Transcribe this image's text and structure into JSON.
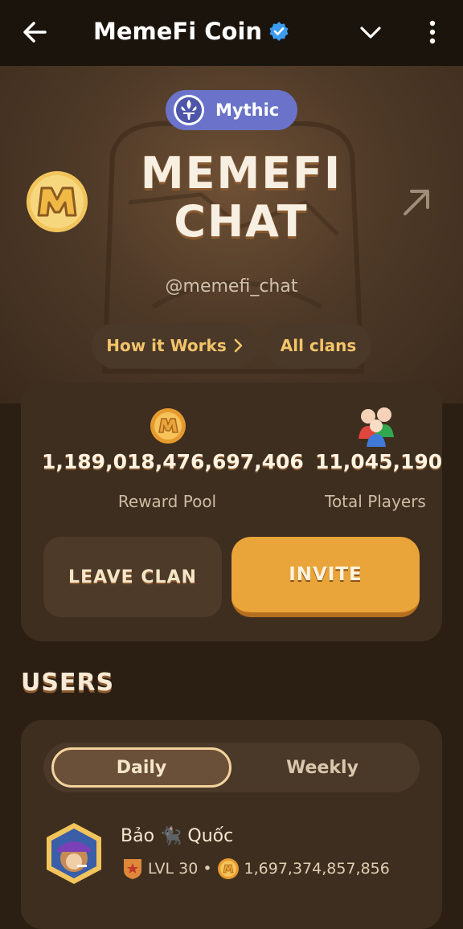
{
  "appbar": {
    "title": "MemeFi Coin"
  },
  "clan": {
    "tier": "Mythic",
    "name_line1": "MEMEFI",
    "name_line2": "CHAT",
    "handle": "@memefi_chat",
    "how_it_works": "How it Works",
    "all_clans": "All clans"
  },
  "stats": {
    "reward_pool_value": "1,189,018,476,697,406",
    "reward_pool_label": "Reward Pool",
    "players_value": "11,045,190",
    "players_label": "Total Players"
  },
  "actions": {
    "leave": "LEAVE CLAN",
    "invite": "INVITE"
  },
  "users": {
    "title": "USERS",
    "tabs": [
      "Daily",
      "Weekly"
    ],
    "active_tab": "Daily",
    "items": [
      {
        "name": "Bảo 🐈‍⬛ Quốc",
        "level": "LVL 30",
        "separator": "•",
        "coins": "1,697,374,857,856"
      }
    ]
  },
  "colors": {
    "accent": "#e9a43a",
    "background": "#2b1f14",
    "card": "#3e2e1f",
    "tier_badge": "#6a73c9"
  }
}
